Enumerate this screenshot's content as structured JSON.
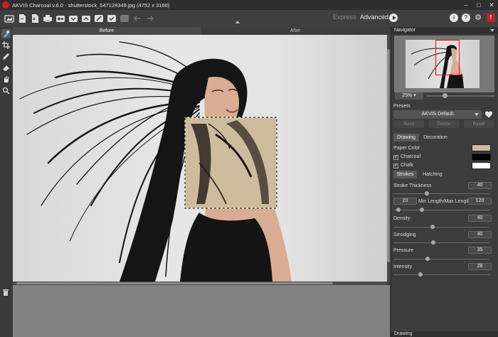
{
  "window": {
    "title": "AKVIS Charcoal v.6.0 - shutterstock_547128349.jpg (4752 x 3168)",
    "controls": [
      "minimize-icon",
      "maximize-icon",
      "close-icon"
    ]
  },
  "toolbar": {
    "icons": [
      "home-icon",
      "open-file-icon",
      "save-icon",
      "print-icon",
      "batch-icon",
      "preset-load-icon",
      "preset-save-icon",
      "brush-icon",
      "apply-icon",
      "share-icon",
      "undo-icon",
      "redo-icon"
    ],
    "mode_express": "Express",
    "mode_advanced": "Advanced",
    "right_icons": [
      "info-icon",
      "help-icon",
      "settings-icon",
      "notifications-icon"
    ]
  },
  "tools": [
    "preview-tool",
    "crop-tool",
    "pencil-tool",
    "eraser-tool",
    "hand-tool",
    "zoom-tool"
  ],
  "canvas": {
    "tab_before": "Before",
    "tab_after": "After"
  },
  "navigator": {
    "header": "Navigator",
    "zoom": "25%"
  },
  "presets": {
    "label": "Presets",
    "selected": "AKVIS Default",
    "save": "Save",
    "delete": "Delete",
    "reset": "Reset"
  },
  "tabs_main": {
    "drawing": "Drawing",
    "decoration": "Decoration"
  },
  "colors": {
    "paper_label": "Paper Color",
    "paper": "#cdbb9d",
    "charcoal_label": "Charcoal",
    "charcoal": "#000000",
    "chalk_label": "Chalk",
    "chalk": "#ffffff",
    "check": "✓"
  },
  "tabs_sub": {
    "strokes": "Strokes",
    "hatching": "Hatching"
  },
  "params": {
    "stroke_thickness": {
      "label": "Stroke Thickness",
      "value": 40
    },
    "min_max": {
      "label": "Min Length/Max Length",
      "min": 20,
      "max": 120
    },
    "density": {
      "label": "Density",
      "value": 40
    },
    "smudging": {
      "label": "Smudging",
      "value": 40
    },
    "pressure": {
      "label": "Pressure",
      "value": 35
    },
    "intensity": {
      "label": "Intensity",
      "value": 28
    }
  },
  "bottom_tab": "Drawing"
}
